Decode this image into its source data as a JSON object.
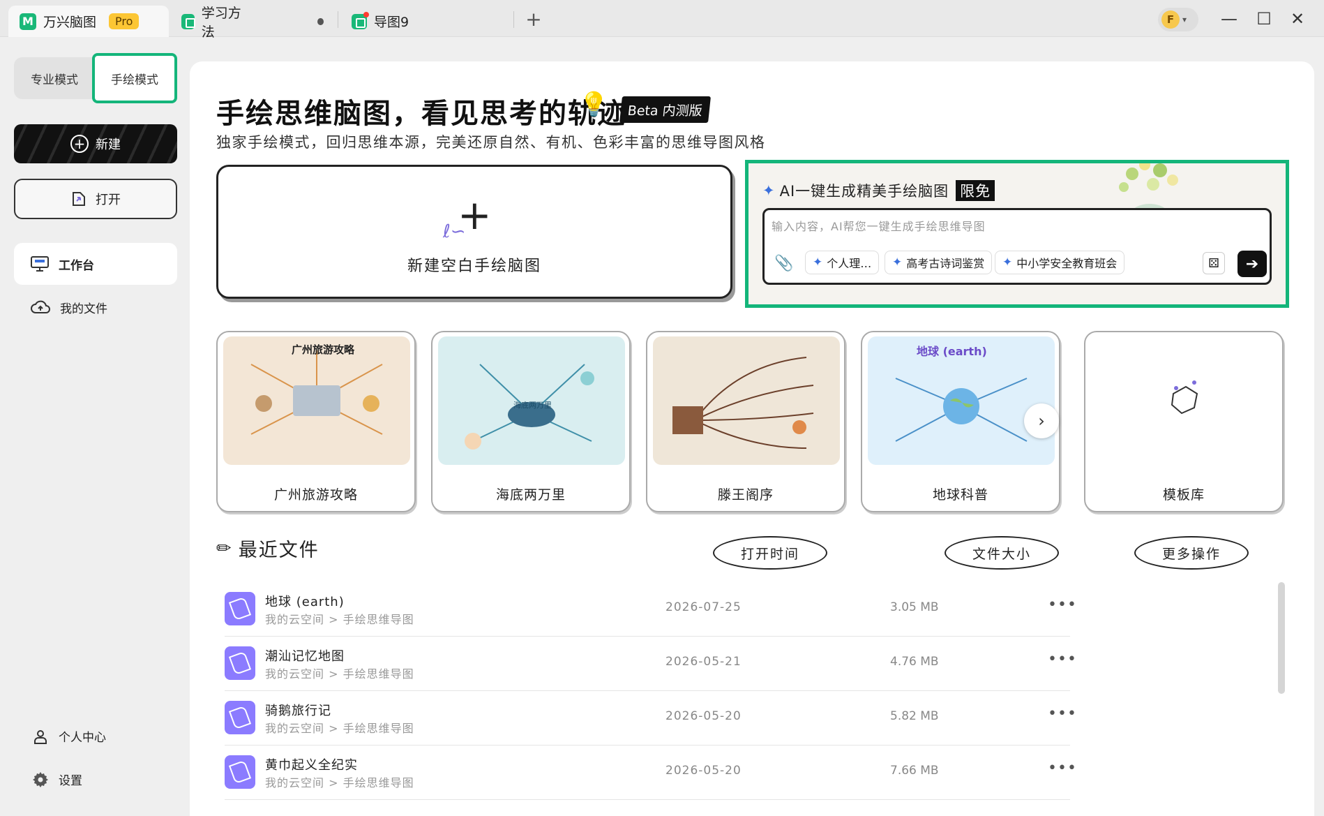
{
  "titlebar": {
    "app_name": "万兴脑图",
    "pro_label": "Pro",
    "tabs": [
      {
        "label": "学习方法",
        "unsaved": true
      },
      {
        "label": "导图9",
        "has_notification": true
      }
    ],
    "add_tab_symbol": "+",
    "user_initial": "F",
    "window_controls": {
      "minimize": "—",
      "maximize": "☐",
      "close": "✕"
    }
  },
  "sidebar": {
    "modes": [
      "专业模式",
      "手绘模式"
    ],
    "active_mode": "手绘模式",
    "new_label": "新建",
    "open_label": "打开",
    "nav": [
      {
        "label": "工作台",
        "icon": "monitor-icon",
        "active": true
      },
      {
        "label": "我的文件",
        "icon": "cloud-icon",
        "active": false
      }
    ],
    "bottom": [
      {
        "label": "个人中心",
        "icon": "user-icon"
      },
      {
        "label": "设置",
        "icon": "gear-icon"
      }
    ]
  },
  "hero": {
    "title": "手绘思维脑图，看见思考的轨迹",
    "beta_badge": "Beta 内测版",
    "subtitle": "独家手绘模式，回归思维本源，完美还原自然、有机、色彩丰富的思维导图风格"
  },
  "blank_card": {
    "label": "新建空白手绘脑图"
  },
  "ai_box": {
    "title": "AI一键生成精美手绘脑图",
    "badge": "限免",
    "placeholder": "输入内容，AI帮您一键生成手绘思维导图",
    "chips": [
      "个人理…",
      "高考古诗词鉴赏",
      "中小学安全教育班会"
    ],
    "send_symbol": "➔"
  },
  "templates": [
    {
      "name": "广州旅游攻略",
      "thumb_title": "广州旅游攻略",
      "color": "#f3e6d6"
    },
    {
      "name": "海底两万里",
      "thumb_title": "海底两万里",
      "color": "#d9eef0"
    },
    {
      "name": "滕王阁序",
      "thumb_title": "",
      "color": "#efe6d8"
    },
    {
      "name": "地球科普",
      "thumb_title": "地球 (earth)",
      "color": "#dff0fb"
    },
    {
      "name": "模板库",
      "thumb_title": "",
      "color": "#ffffff"
    }
  ],
  "recent": {
    "title": "最近文件",
    "sort_buttons": [
      "打开时间",
      "文件大小",
      "更多操作"
    ],
    "files": [
      {
        "name": "地球 (earth)",
        "path": "我的云空间 > 手绘思维导图",
        "date": "2026-07-25",
        "size": "3.05 MB"
      },
      {
        "name": "潮汕记忆地图",
        "path": "我的云空间 > 手绘思维导图",
        "date": "2026-05-21",
        "size": "4.76 MB"
      },
      {
        "name": "骑鹅旅行记",
        "path": "我的云空间 > 手绘思维导图",
        "date": "2026-05-20",
        "size": "5.82 MB"
      },
      {
        "name": "黄巾起义全纪实",
        "path": "我的云空间 > 手绘思维导图",
        "date": "2026-05-20",
        "size": "7.66 MB"
      }
    ],
    "more_symbol": "•••"
  },
  "colors": {
    "accent_green": "#14b57a",
    "pro_yellow": "#fcc634",
    "file_icon_purple": "#8b7bff"
  }
}
